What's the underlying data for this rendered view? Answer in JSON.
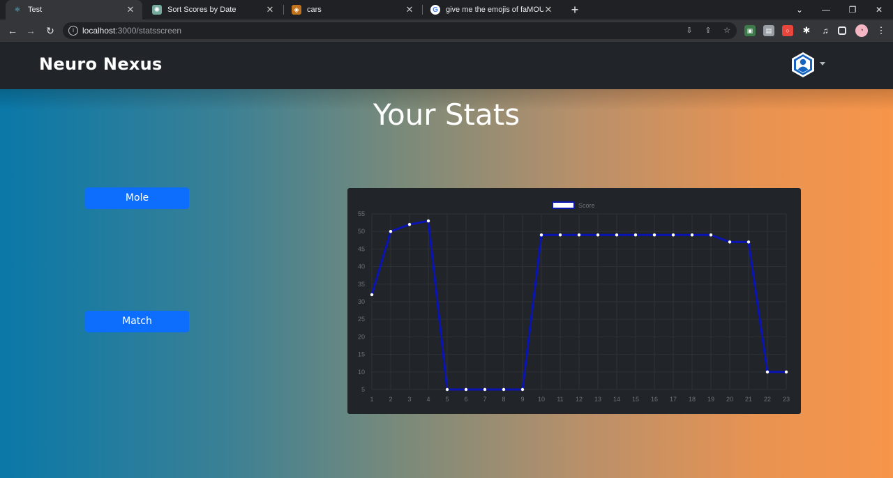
{
  "browser": {
    "tabs": [
      {
        "title": "Test",
        "icon": "react-icon",
        "active": true
      },
      {
        "title": "Sort Scores by Date",
        "icon": "chatgpt-icon",
        "active": false
      },
      {
        "title": "cars",
        "icon": "stackoverflow-icon",
        "active": false
      },
      {
        "title": "give me the emojis of faMOUS C",
        "icon": "google-icon",
        "active": false
      }
    ],
    "new_tab": "+",
    "url_host": "localhost",
    "url_path": ":3000/statsscreen"
  },
  "navbar": {
    "brand": "Neuro Nexus",
    "avatar_icon": "user-avatar-icon"
  },
  "main": {
    "title": "Your Stats",
    "buttons": {
      "mole": "Mole",
      "match": "Match"
    }
  },
  "colors": {
    "navbar_bg": "#212529",
    "button_bg": "#0d6efd",
    "line": "#0a14b4",
    "gradient_start": "#0a78a8",
    "gradient_end": "#f7954a"
  },
  "chart_data": {
    "type": "line",
    "legend": [
      "Score"
    ],
    "legend_position": "top",
    "grid": true,
    "ylim": [
      5,
      55
    ],
    "y_ticks": [
      5,
      10,
      15,
      20,
      25,
      30,
      35,
      40,
      45,
      50,
      55
    ],
    "x": [
      1,
      2,
      3,
      4,
      5,
      6,
      7,
      8,
      9,
      10,
      11,
      12,
      13,
      14,
      15,
      16,
      17,
      18,
      19,
      20,
      21,
      22,
      23
    ],
    "series": [
      {
        "name": "Score",
        "values": [
          32,
          50,
          52,
          53,
          5,
          5,
          5,
          5,
          5,
          49,
          49,
          49,
          49,
          49,
          49,
          49,
          49,
          49,
          49,
          47,
          47,
          10,
          10
        ]
      }
    ]
  }
}
